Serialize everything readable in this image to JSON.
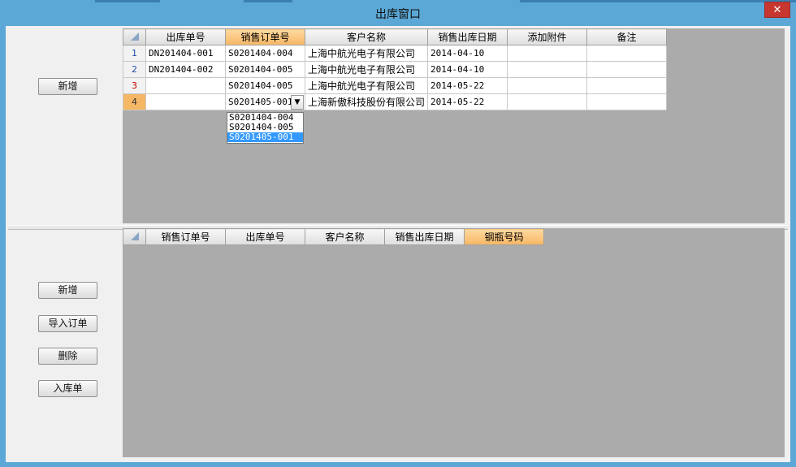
{
  "window": {
    "title": "出库窗口",
    "close_glyph": "✕"
  },
  "top_panel": {
    "add_button": "新增",
    "columns": [
      "出库单号",
      "销售订单号",
      "客户名称",
      "销售出库日期",
      "添加附件",
      "备注"
    ],
    "rows": [
      {
        "num": "1",
        "out_no": "DN201404-001",
        "order_no": "S0201404-004",
        "customer": "上海中航光电子有限公司",
        "date": "2014-04-10",
        "attach": "",
        "note": ""
      },
      {
        "num": "2",
        "out_no": "DN201404-002",
        "order_no": "S0201404-005",
        "customer": "上海中航光电子有限公司",
        "date": "2014-04-10",
        "attach": "",
        "note": ""
      },
      {
        "num": "3",
        "out_no": "",
        "order_no": "S0201404-005",
        "customer": "上海中航光电子有限公司",
        "date": "2014-05-22",
        "attach": "",
        "note": ""
      },
      {
        "num": "4",
        "out_no": "",
        "order_no": "S0201405-001",
        "customer": "上海新傲科技股份有限公司",
        "date": "2014-05-22",
        "attach": "",
        "note": ""
      }
    ],
    "combo_arrow_icon": "chevron-down-icon",
    "dropdown_options": [
      "S0201404-004",
      "S0201404-005",
      "S0201405-001"
    ],
    "dropdown_selected": "S0201405-001"
  },
  "bottom_panel": {
    "columns": [
      "销售订单号",
      "出库单号",
      "客户名称",
      "销售出库日期",
      "钢瓶号码"
    ],
    "buttons": {
      "add": "新增",
      "import": "导入订单",
      "delete": "删除",
      "stock_in": "入库单"
    }
  },
  "colors": {
    "title_bar": "#5ba8d6",
    "grid_background": "#ababab",
    "active_header": "#f5b765",
    "selection": "#3399ff",
    "close_button": "#c7372f"
  }
}
